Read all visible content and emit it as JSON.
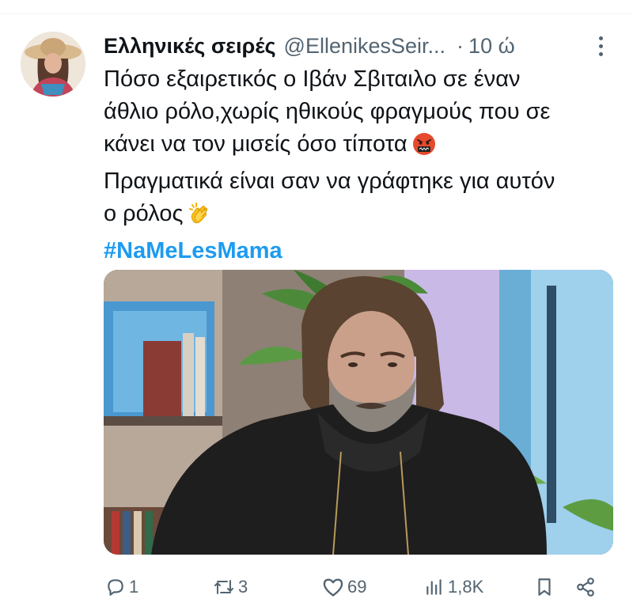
{
  "tweet": {
    "author": {
      "display_name": "Ελληνικές σειρές",
      "handle": "@EllenikesSeir...",
      "separator": "·",
      "time": "10 ώ"
    },
    "text_lines": [
      "Πόσο εξαιρετικός ο Ιβάν Σβιταιλο σε έναν",
      "άθλιο ρόλο,χωρίς ηθικούς φραγμούς που σε",
      "κάνει να τον μισείς όσο τίποτα",
      "Πραγματικά είναι σαν να γράφτηκε για αυτόν",
      "ο ρόλος"
    ],
    "emojis": [
      "angry-face-emoji",
      "clapping-hands-emoji"
    ],
    "hashtag": "#NaMeLesMama",
    "media_description": "photo of a bearded man with long hair in a black hoodie in a TV studio",
    "actions": {
      "replies": "1",
      "reposts": "3",
      "likes": "69",
      "views": "1,8K"
    }
  },
  "colors": {
    "text": "#0f1419",
    "secondary": "#536471",
    "hashtag": "#1d9bf0",
    "divider": "#eff3f4"
  }
}
